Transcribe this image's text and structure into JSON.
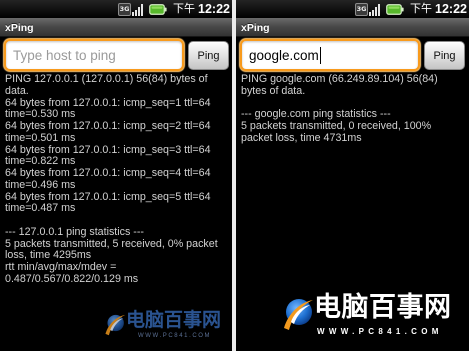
{
  "screens": [
    {
      "status_bar": {
        "network_label": "3G",
        "time_period": "下午",
        "time": "12:22",
        "icons": [
          "3g-icon",
          "signal-strength-icon",
          "battery-icon"
        ]
      },
      "title": "xPing",
      "host_input": {
        "placeholder": "Type host to ping"
      },
      "ping_button": {
        "label": "Ping"
      },
      "output": {
        "lines": [
          "PING 127.0.0.1 (127.0.0.1) 56(84) bytes of",
          "data.",
          "64 bytes from 127.0.0.1: icmp_seq=1 ttl=64",
          "time=0.530 ms",
          "64 bytes from 127.0.0.1: icmp_seq=2 ttl=64",
          "time=0.501 ms",
          "64 bytes from 127.0.0.1: icmp_seq=3 ttl=64",
          "time=0.822 ms",
          "64 bytes from 127.0.0.1: icmp_seq=4 ttl=64",
          "time=0.496 ms",
          "64 bytes from 127.0.0.1: icmp_seq=5 ttl=64",
          "time=0.487 ms"
        ],
        "statistics_lines": [
          "--- 127.0.0.1 ping statistics ---",
          "5 packets transmitted, 5 received, 0% packet",
          "loss, time 4295ms",
          "rtt min/avg/max/mdev =",
          "0.487/0.567/0.822/0.129 ms"
        ]
      }
    },
    {
      "status_bar": {
        "network_label": "3G",
        "time_period": "下午",
        "time": "12:22",
        "icons": [
          "3g-icon",
          "signal-strength-icon",
          "battery-icon"
        ]
      },
      "title": "xPing",
      "host_input": {
        "value": "google.com"
      },
      "ping_button": {
        "label": "Ping"
      },
      "output": {
        "lines": [
          "PING google.com (66.249.89.104) 56(84)",
          "bytes of data."
        ],
        "statistics_lines": [
          "--- google.com ping statistics ---",
          "5 packets transmitted, 0 received, 100%",
          "packet loss, time 4731ms"
        ]
      }
    }
  ],
  "watermark": {
    "site_name": "电脑百事网",
    "site_url": "WWW.PC841.COM",
    "icon": "pc841-logo-icon"
  },
  "colors": {
    "focus_border": "#f89a1c",
    "output_text": "#d2d2d2",
    "placeholder_text": "#9a9a9a",
    "watermark_blue": "#3466b0",
    "watermark_orange": "#f39a1e"
  }
}
